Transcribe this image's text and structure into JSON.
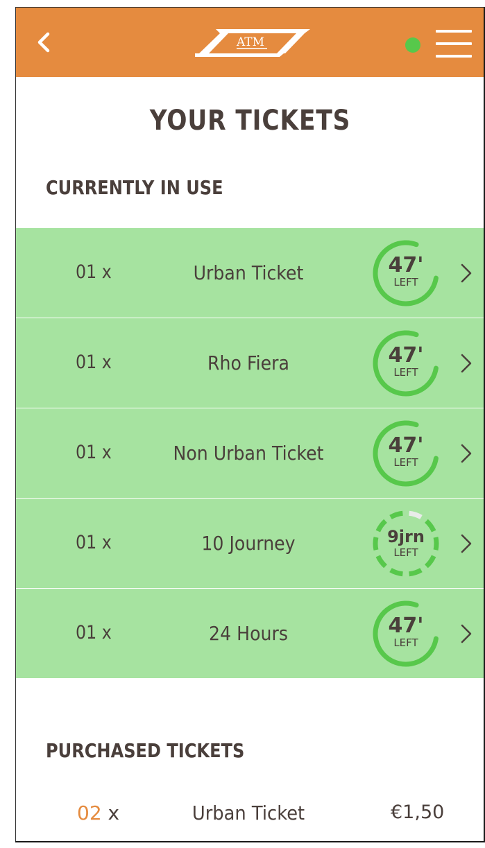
{
  "header": {
    "logo_text": "ATM",
    "back_icon": "chevron-left-icon",
    "menu_icon": "hamburger-menu-icon",
    "status_color": "#57c84b",
    "brand_color": "#e58b3f"
  },
  "page_title": "YOUR TICKETS",
  "in_use": {
    "label": "CURRENTLY IN USE",
    "tickets": [
      {
        "qty": "01 x",
        "name": "Urban Ticket",
        "remaining_value": "47'",
        "remaining_label": "LEFT",
        "kind": "time",
        "progress": 0.78
      },
      {
        "qty": "01 x",
        "name": "Rho Fiera",
        "remaining_value": "47'",
        "remaining_label": "LEFT",
        "kind": "time",
        "progress": 0.78
      },
      {
        "qty": "01 x",
        "name": "Non Urban Ticket",
        "remaining_value": "47'",
        "remaining_label": "LEFT",
        "kind": "time",
        "progress": 0.78
      },
      {
        "qty": "01 x",
        "name": "10 Journey",
        "remaining_value": "9jrn",
        "remaining_label": "LEFT",
        "kind": "journeys",
        "used": 1,
        "total": 10
      },
      {
        "qty": "01 x",
        "name": "24 Hours",
        "remaining_value": "47'",
        "remaining_label": "LEFT",
        "kind": "time",
        "progress": 0.78
      }
    ]
  },
  "purchased": {
    "label": "PURCHASED TICKETS",
    "items": [
      {
        "qty_num": "02",
        "qty_suffix": " x",
        "name": "Urban Ticket",
        "price": "€1,50"
      }
    ]
  }
}
